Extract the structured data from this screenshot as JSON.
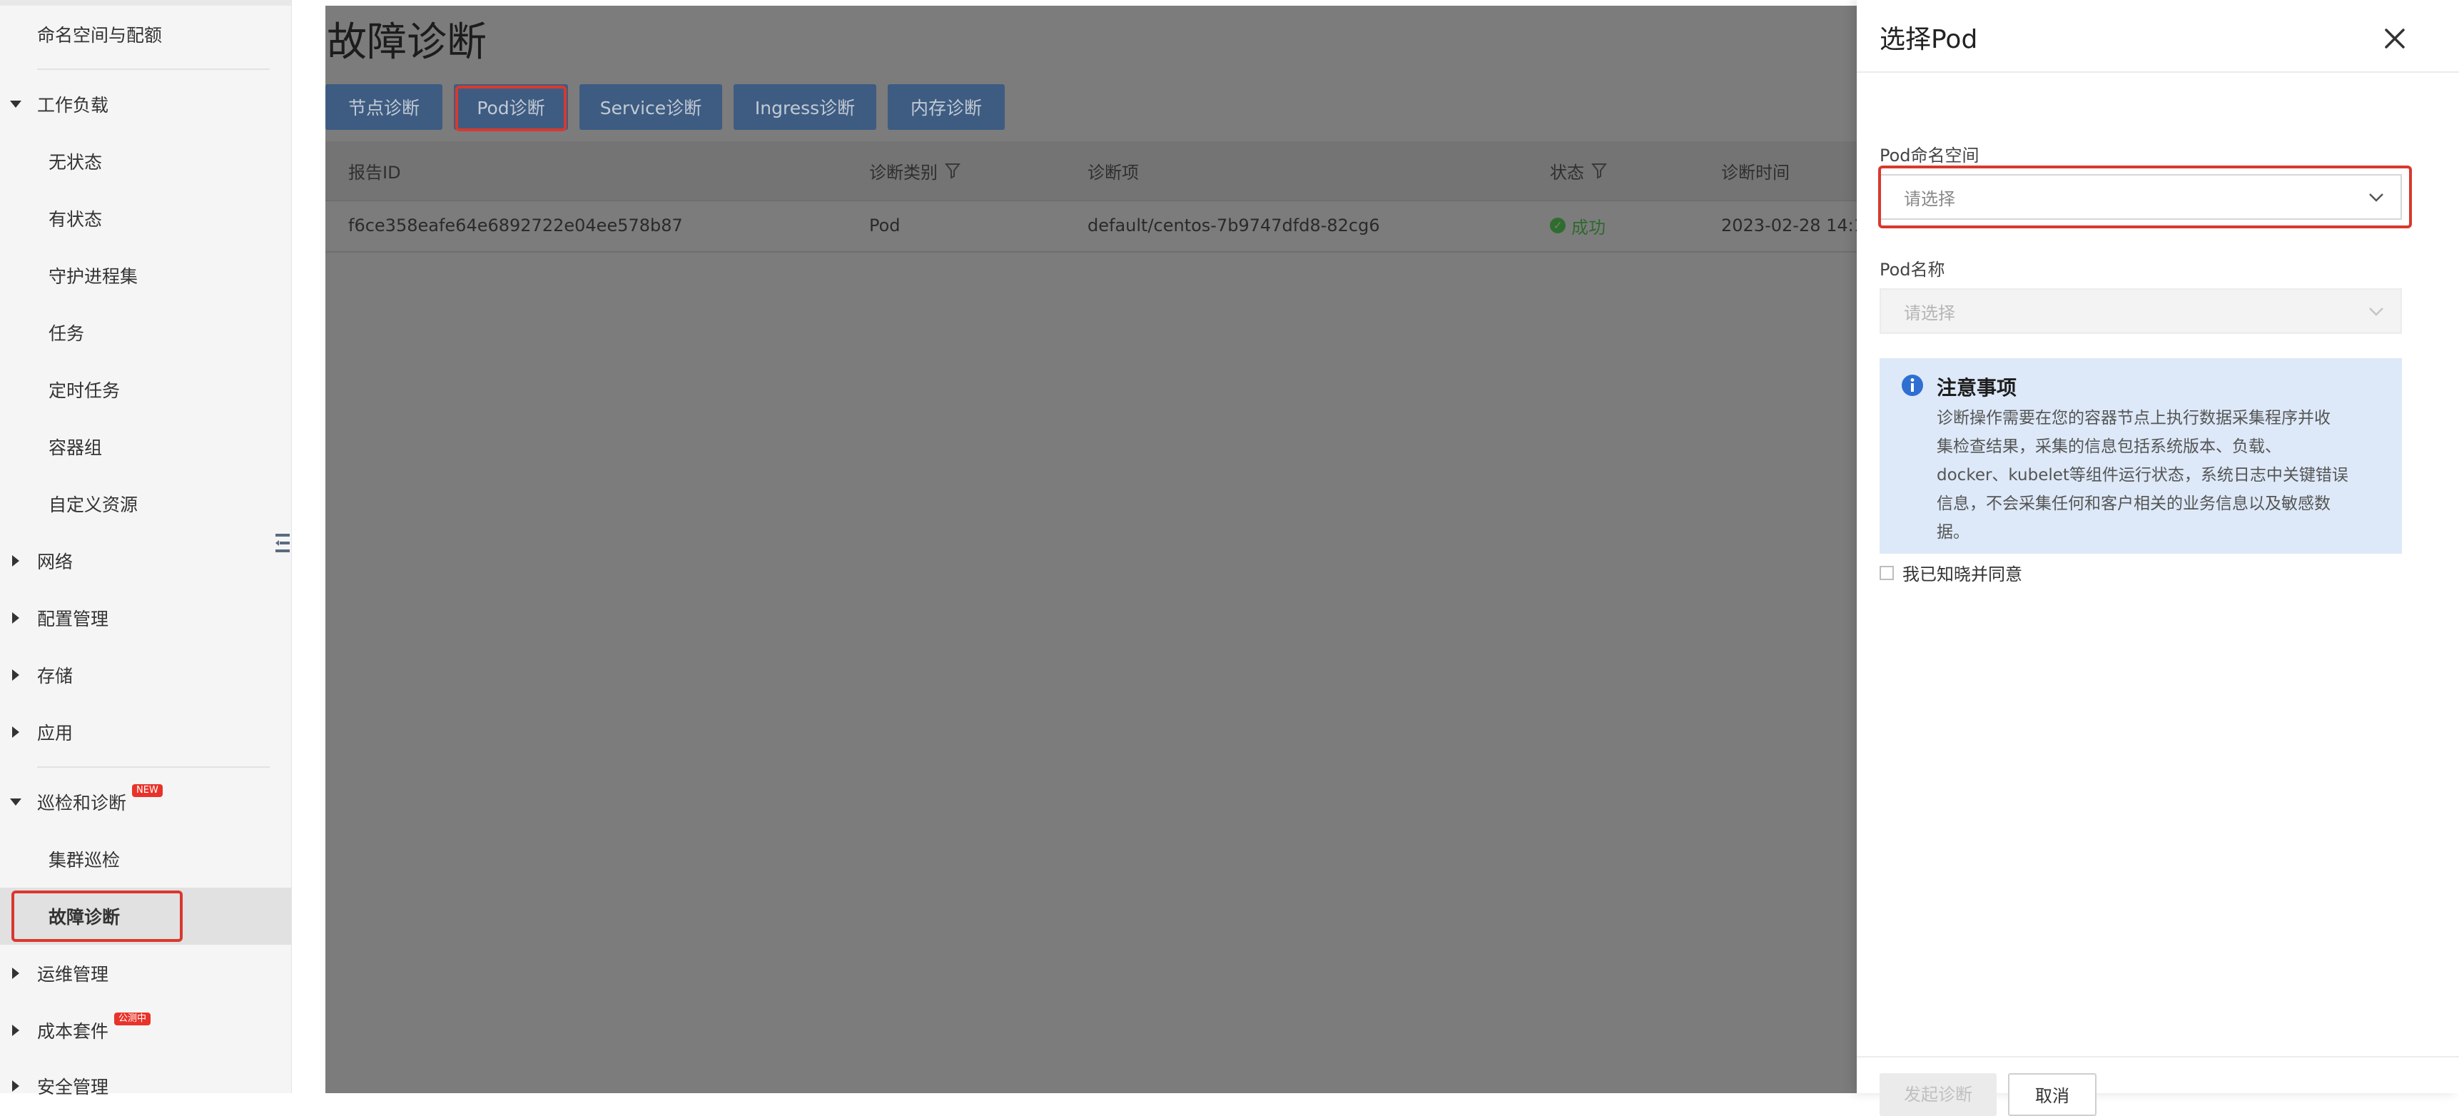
{
  "sidebar": {
    "items": [
      {
        "label": "命名空间与配额",
        "kind": "sub-top"
      },
      {
        "label": "工作负载",
        "kind": "group-open"
      },
      {
        "label": "无状态",
        "kind": "sub"
      },
      {
        "label": "有状态",
        "kind": "sub"
      },
      {
        "label": "守护进程集",
        "kind": "sub"
      },
      {
        "label": "任务",
        "kind": "sub"
      },
      {
        "label": "定时任务",
        "kind": "sub"
      },
      {
        "label": "容器组",
        "kind": "sub"
      },
      {
        "label": "自定义资源",
        "kind": "sub"
      },
      {
        "label": "网络",
        "kind": "group"
      },
      {
        "label": "配置管理",
        "kind": "group"
      },
      {
        "label": "存储",
        "kind": "group"
      },
      {
        "label": "应用",
        "kind": "group"
      },
      {
        "label": "巡检和诊断",
        "kind": "group-open",
        "badge": "NEW"
      },
      {
        "label": "集群巡检",
        "kind": "sub"
      },
      {
        "label": "故障诊断",
        "kind": "sub",
        "active": true
      },
      {
        "label": "运维管理",
        "kind": "group"
      },
      {
        "label": "成本套件",
        "kind": "group",
        "badge": "公测中"
      },
      {
        "label": "安全管理",
        "kind": "group"
      }
    ]
  },
  "main": {
    "title": "故障诊断",
    "tabs": [
      "节点诊断",
      "Pod诊断",
      "Service诊断",
      "Ingress诊断",
      "内存诊断"
    ],
    "table": {
      "headers": [
        "报告ID",
        "诊断类别",
        "诊断项",
        "状态",
        "诊断时间"
      ],
      "rows": [
        {
          "report_id": "f6ce358eafe64e6892722e04ee578b87",
          "category": "Pod",
          "item": "default/centos-7b9747dfd8-82cg6",
          "status": "成功",
          "time": "2023-02-28 14:1"
        }
      ]
    }
  },
  "drawer": {
    "title": "选择Pod",
    "namespace_label": "Pod命名空间",
    "namespace_placeholder": "请选择",
    "name_label": "Pod名称",
    "name_placeholder": "请选择",
    "notice_title": "注意事项",
    "notice_lines": [
      "诊断操作需要在您的容器节点上执行数据采集程序并收",
      "集检查结果，采集的信息包括系统版本、负载、",
      "docker、kubelet等组件运行状态，系统日志中关键错误",
      "信息，不会采集任何和客户相关的业务信息以及敏感数",
      "据。"
    ],
    "agree_label": "我已知晓并同意",
    "start_button": "发起诊断",
    "cancel_button": "取消"
  },
  "colors": {
    "highlight": "#d9382e",
    "tab_bg": "#3e5c82",
    "notice_bg": "#dde9f8",
    "badge": "#e8332b",
    "success": "#2f6d2f"
  }
}
